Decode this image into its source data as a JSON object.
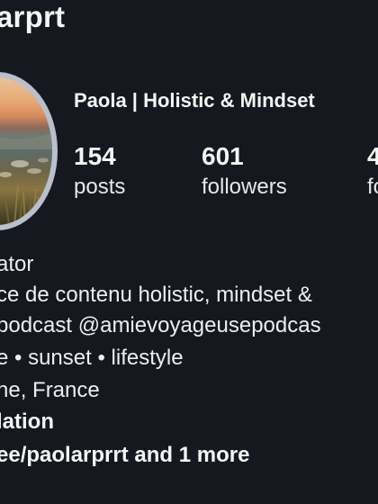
{
  "header": {
    "username": "arprt"
  },
  "profile": {
    "display_name": "Paola | Holistic & Mindset",
    "avatar_icon": "avatar-sunset-landscape",
    "ring_color": "#b9c0cc"
  },
  "stats": {
    "posts": {
      "value": "154",
      "label": "posts"
    },
    "followers": {
      "value": "601",
      "label": "followers"
    },
    "following": {
      "value": "4",
      "label": "fo"
    }
  },
  "bio": {
    "category": "ator",
    "line1": "ce de contenu holistic, mindset &",
    "line2": "podcast @amievoyageusepodcas",
    "line3": "e • sunset • lifestyle",
    "location": "ne, France",
    "bold_line": "lation",
    "link": "ee/paolarprrt and 1 more"
  },
  "colors": {
    "background": "#16181f",
    "text": "#f5f5f5"
  }
}
